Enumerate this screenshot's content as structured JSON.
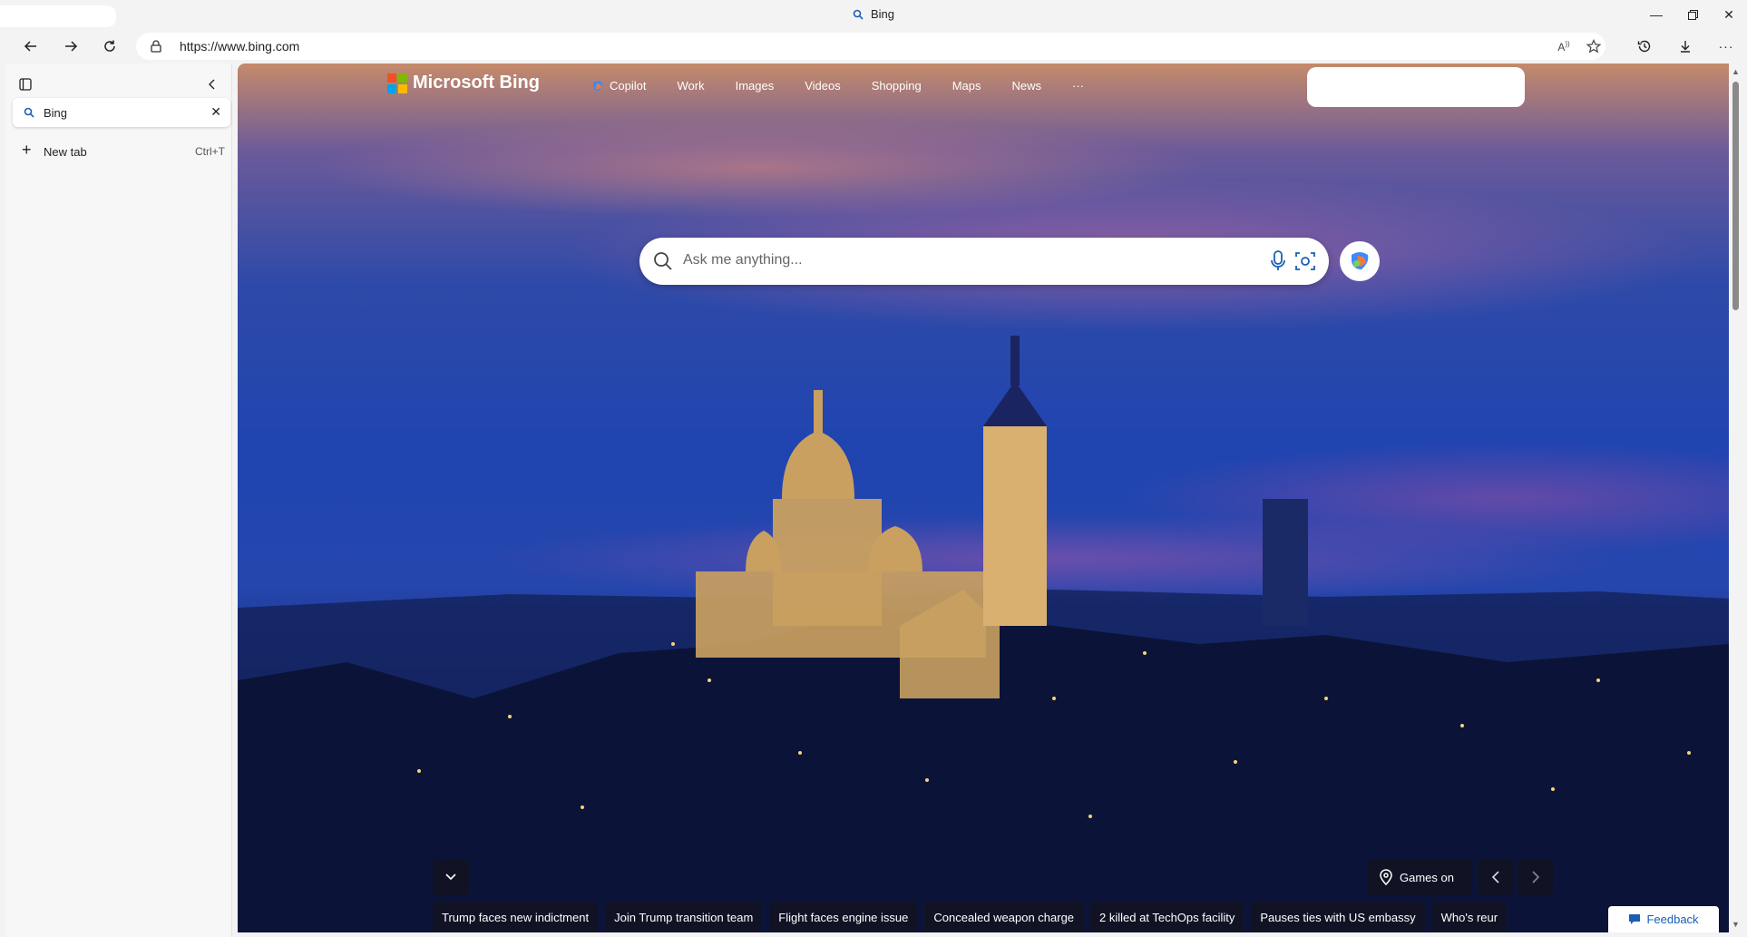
{
  "window": {
    "title": "Bing",
    "controls": [
      "minimize-icon",
      "restore-icon",
      "close-icon"
    ]
  },
  "toolbar": {
    "url": "https://www.bing.com",
    "icons": [
      "back-icon",
      "forward-icon",
      "refresh-icon",
      "lock-icon",
      "read-aloud-icon",
      "favorite-star-icon",
      "history-icon",
      "download-icon",
      "more-icon"
    ]
  },
  "sidebar": {
    "active_tab": {
      "label": "Bing"
    },
    "new_tab": {
      "label": "New tab",
      "shortcut": "Ctrl+T"
    }
  },
  "page": {
    "logo_text": "Microsoft Bing",
    "nav": [
      "Copilot",
      "Work",
      "Images",
      "Videos",
      "Shopping",
      "Maps",
      "News",
      "···"
    ],
    "search": {
      "placeholder": "Ask me anything..."
    },
    "games_label": "Games on",
    "news": [
      "Trump faces new indictment",
      "Join Trump transition team",
      "Flight faces engine issue",
      "Concealed weapon charge",
      "2 killed at TechOps facility",
      "Pauses ties with US embassy",
      "Who's reur"
    ],
    "feedback_label": "Feedback"
  },
  "colors": {
    "accent": "#1a5fb4",
    "ms_red": "#f25022",
    "ms_green": "#7fba00",
    "ms_blue": "#00a4ef",
    "ms_yellow": "#ffb900"
  }
}
